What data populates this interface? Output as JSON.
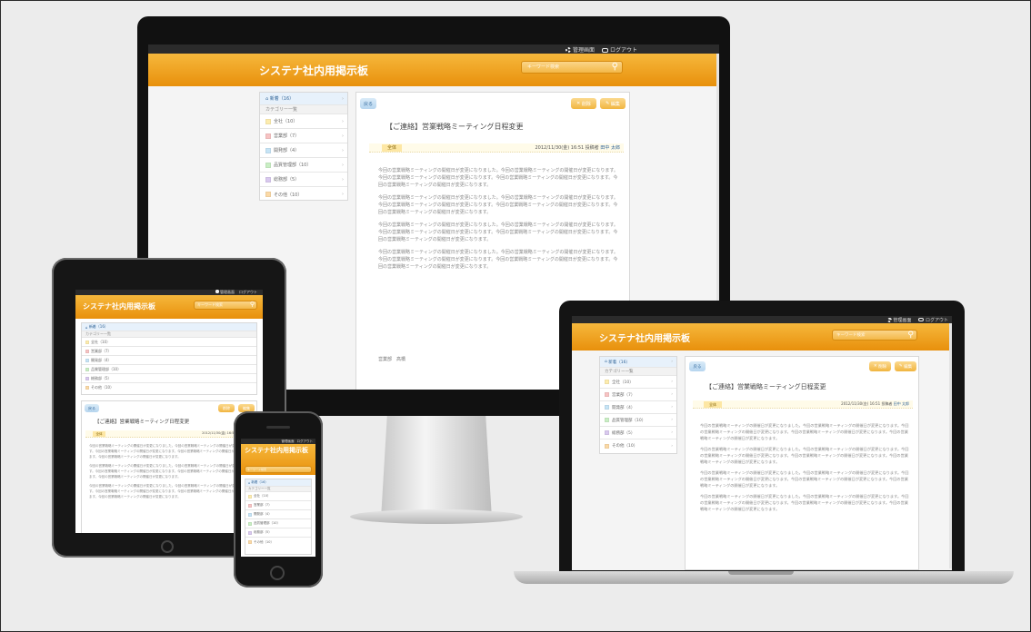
{
  "app": {
    "name": "システナ社内用掲示板",
    "settings": "管理画面",
    "logout": "ログアウト",
    "search_placeholder": "キーワード検索"
  },
  "sidebar": {
    "all": "新着（16）",
    "cathead": "カテゴリー一覧",
    "items": [
      {
        "label": "全社（10）",
        "color": "#fdecae"
      },
      {
        "label": "営業部（7）",
        "color": "#f7c3c3"
      },
      {
        "label": "開発部（4）",
        "color": "#c6e4f6"
      },
      {
        "label": "品質管理部（10）",
        "color": "#c9eec4"
      },
      {
        "label": "総務部（5）",
        "color": "#d9c9ef"
      },
      {
        "label": "その他（10）",
        "color": "#fbd9a6"
      }
    ]
  },
  "post": {
    "back": "戻る",
    "delete": "削除",
    "edit": "編集",
    "title": "【ご連絡】営業戦略ミーティング日程変更",
    "tag": "全体",
    "date": "2012/11/30(金) 16:51",
    "author_label": "投稿者",
    "author": "田中 太郎",
    "paragraph": "今回の営業戦略ミーティングの開催日が変更になりました。今回の営業戦略ミーティングの開催日が変更になります。今回の営業戦略ミーティングの開催日が変更になります。今回の営業戦略ミーティングの開催日が変更になります。今回の営業戦略ミーティングの開催日が変更になります。",
    "signature": "営業部　高橋"
  },
  "phone": {
    "subtitle": "カテゴリー一覧"
  },
  "colors": {
    "header_orange": "#ec9a14",
    "accent_blue": "#336699",
    "bezel": "#111111"
  }
}
